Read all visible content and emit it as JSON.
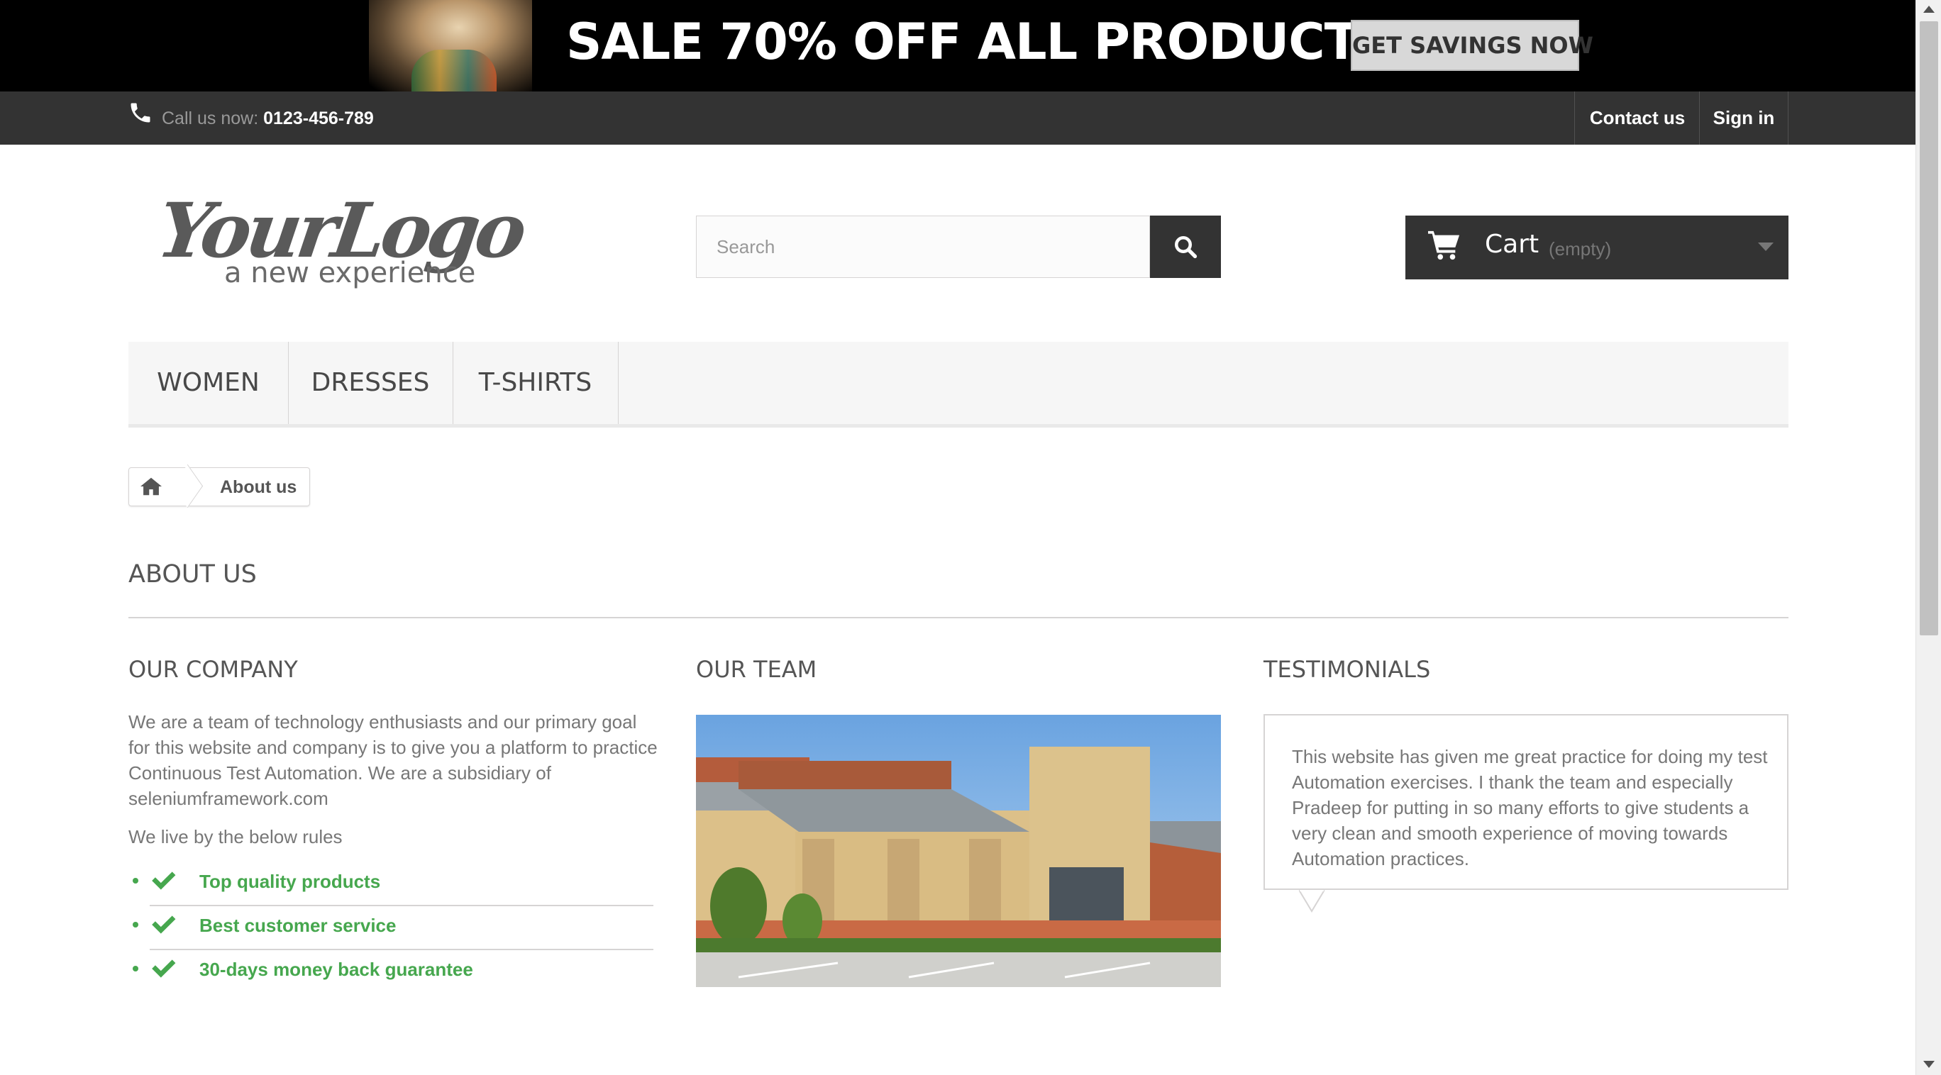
{
  "banner": {
    "title": "SALE 70% OFF ALL PRODUCTS",
    "button_label": "GET SAVINGS NOW"
  },
  "topbar": {
    "call_label": "Call us now: ",
    "phone": "0123-456-789",
    "contact_label": "Contact us",
    "signin_label": "Sign in"
  },
  "header": {
    "logo_main": "YourLogo",
    "logo_tagline": "a new experience",
    "search_placeholder": "Search",
    "cart_label": "Cart",
    "cart_status": "(empty)"
  },
  "menu": {
    "items": [
      "WOMEN",
      "DRESSES",
      "T-SHIRTS"
    ]
  },
  "breadcrumb": {
    "current": "About us"
  },
  "page": {
    "title": "ABOUT US"
  },
  "company": {
    "heading": "OUR COMPANY",
    "paragraph": "We are a team of technology enthusiasts and our primary goal for this website and company is to give you a platform to practice Continuous Test Automation. We are a subsidiary of seleniumframework.com",
    "rules_intro": "We live by the below rules",
    "rules": [
      "Top quality products",
      "Best customer service",
      "30-days money back guarantee"
    ]
  },
  "team": {
    "heading": "OUR TEAM"
  },
  "testimonials": {
    "heading": "TESTIMONIALS",
    "text": "This website has given me great practice for doing my test Automation exercises. I thank the team and especially Pradeep for putting in so many efforts to give students a very clean and smooth experience of moving towards Automation practices."
  },
  "colors": {
    "dark": "#333333",
    "accent_green": "#46a74e",
    "menu_bg": "#f6f6f6"
  }
}
